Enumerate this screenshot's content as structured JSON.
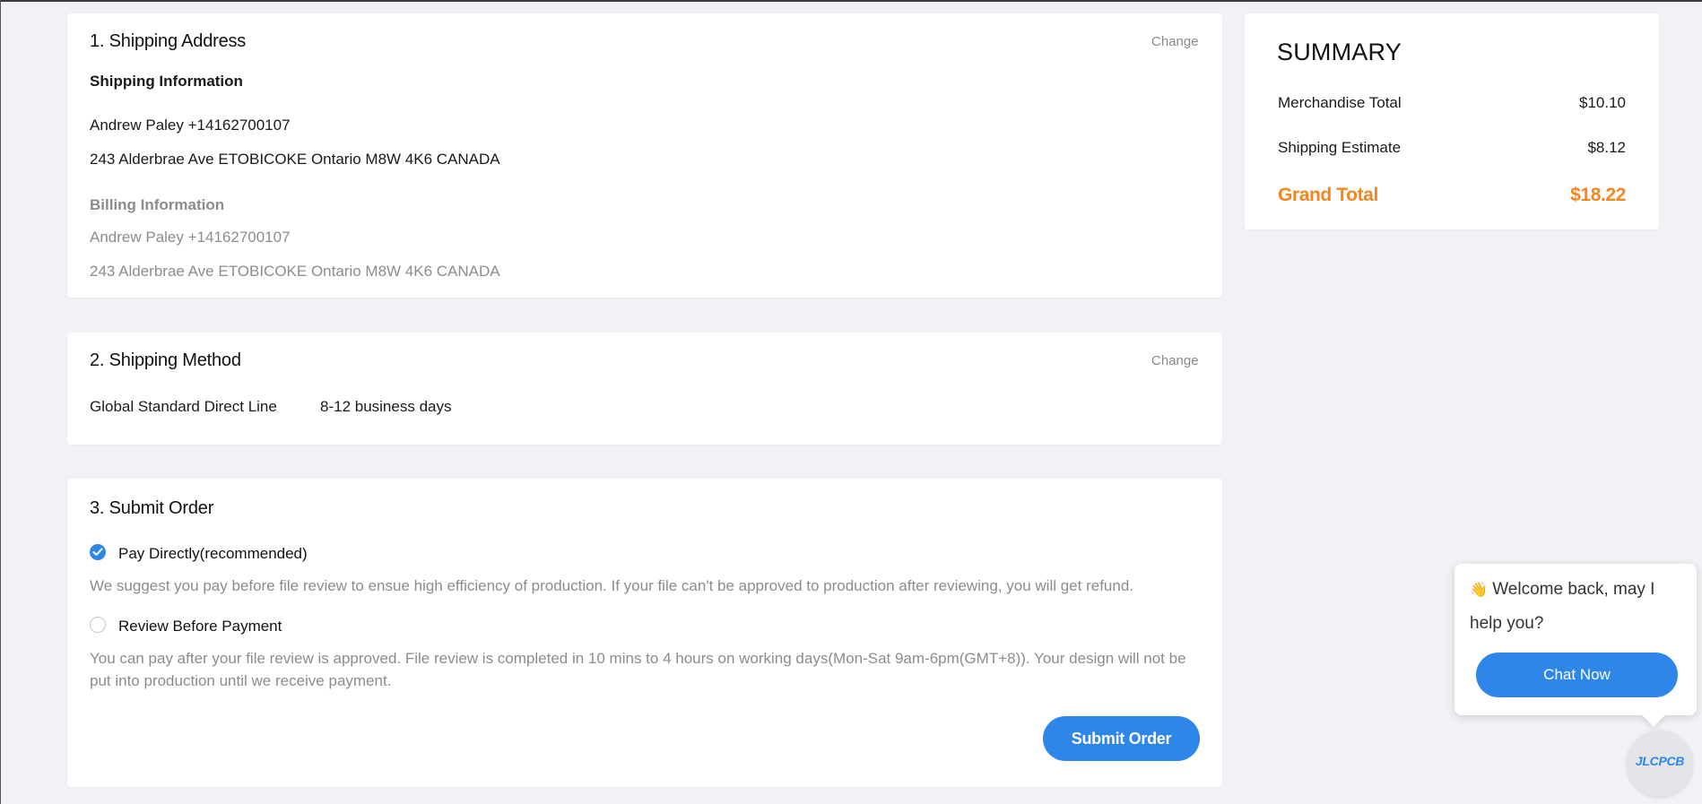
{
  "shipping_address": {
    "title": "1. Shipping Address",
    "change_label": "Change",
    "shipping_heading": "Shipping Information",
    "shipping_name_phone": "Andrew Paley +14162700107",
    "shipping_address_line": "243 Alderbrae Ave ETOBICOKE Ontario M8W 4K6 CANADA",
    "billing_heading": "Billing Information",
    "billing_name_phone": "Andrew Paley +14162700107",
    "billing_address_line": "243 Alderbrae Ave ETOBICOKE Ontario M8W 4K6 CANADA"
  },
  "shipping_method": {
    "title": "2. Shipping Method",
    "change_label": "Change",
    "method_name": "Global Standard Direct Line",
    "delivery_time": "8-12 business days"
  },
  "submit_order": {
    "title": "3. Submit Order",
    "options": [
      {
        "label": "Pay Directly(recommended)",
        "selected": true,
        "description": "We suggest you pay before file review to ensue high efficiency of production. If your file can't be approved to production after reviewing, you will get refund."
      },
      {
        "label": "Review Before Payment",
        "selected": false,
        "description": "You can pay after your file review is approved. File review is completed in 10 mins to 4 hours on working days(Mon-Sat 9am-6pm(GMT+8)). Your design will not be put into production until we receive payment."
      }
    ],
    "submit_label": "Submit Order"
  },
  "summary": {
    "title": "SUMMARY",
    "merchandise_label": "Merchandise Total",
    "merchandise_value": "$10.10",
    "shipping_label": "Shipping Estimate",
    "shipping_value": "$8.12",
    "grand_label": "Grand Total",
    "grand_value": "$18.22"
  },
  "chat": {
    "emoji": "👋",
    "message": "Welcome back, may I help you?",
    "button_label": "Chat Now",
    "logo_text": "JLCPCB"
  },
  "colors": {
    "accent": "#2e87e8",
    "grand_total": "#f5861f",
    "background": "#f1f2f5"
  }
}
